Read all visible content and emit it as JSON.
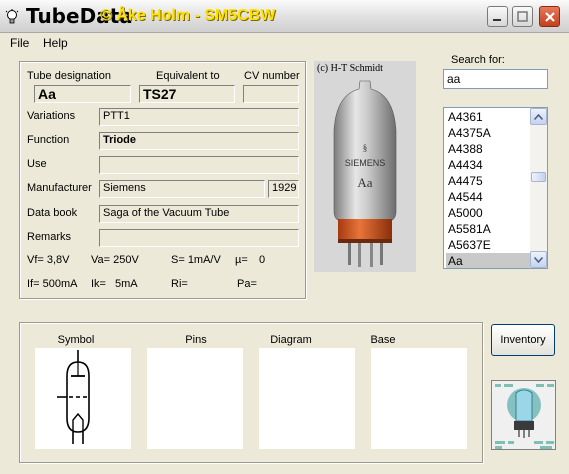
{
  "window": {
    "title": "TubeData",
    "author_overlay": "© Åke Holm - SM5CBW"
  },
  "menu": {
    "file": "File",
    "help": "Help"
  },
  "info": {
    "tube_designation_label": "Tube designation",
    "tube_designation_value": "Aa",
    "equivalent_label": "Equivalent to",
    "equivalent_value": "TS27",
    "cv_label": "CV number",
    "cv_value": "",
    "variations_label": "Variations",
    "variations_value": "PTT1",
    "function_label": "Function",
    "function_value": "Triode",
    "use_label": "Use",
    "use_value": "",
    "manufacturer_label": "Manufacturer",
    "manufacturer_value": "Siemens",
    "year_value": "1929",
    "databook_label": "Data book",
    "databook_value": "Saga of the Vacuum Tube",
    "remarks_label": "Remarks",
    "remarks_value": ""
  },
  "params": {
    "vf": "Vf= 3,8V",
    "va": "Va= 250V",
    "s": "S= 1mA/V",
    "mu": "µ=",
    "mu_value": "0",
    "if": "If= 500mA",
    "ik": "Ik=",
    "ik_value": "5mA",
    "ri": "Ri=",
    "pa": "Pa="
  },
  "photo": {
    "credit": "(c) H-T Schmidt",
    "brand": "SIEMENS",
    "type": "Aa"
  },
  "search": {
    "label": "Search for:",
    "value": "aa"
  },
  "tube_list": [
    "A4361",
    "A4375A",
    "A4388",
    "A4434",
    "A4475",
    "A4544",
    "A5000",
    "A5581A",
    "A5637E",
    "Aa"
  ],
  "tube_list_selected": "Aa",
  "panes": {
    "symbol": "Symbol",
    "pins": "Pins",
    "diagram": "Diagram",
    "base": "Base"
  },
  "buttons": {
    "inventory": "Inventory"
  },
  "colors": {
    "window_bg": "#ece9d8",
    "author_overlay": "#ffe000",
    "close_button": "#c4401d",
    "list_selection": "#c9c9c9"
  }
}
